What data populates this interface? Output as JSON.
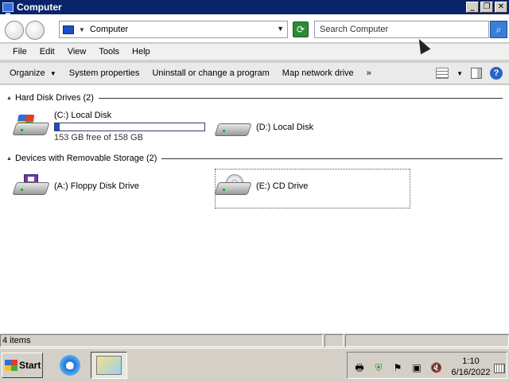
{
  "window": {
    "title": "Computer"
  },
  "title_controls": {
    "minimize": "_",
    "restore": "❐",
    "close": "✕"
  },
  "address": {
    "location": "Computer",
    "search_placeholder": "Search Computer"
  },
  "menu": [
    "File",
    "Edit",
    "View",
    "Tools",
    "Help"
  ],
  "commands": {
    "organize": "Organize",
    "system_properties": "System properties",
    "uninstall": "Uninstall or change a program",
    "map_drive": "Map network drive",
    "more": "»"
  },
  "groups": {
    "hard_disks": {
      "header": "Hard Disk Drives (2)",
      "items": [
        {
          "name": "(C:) Local Disk",
          "free_text": "153 GB free of 158 GB",
          "used_fraction": 0.03
        },
        {
          "name": "(D:) Local Disk"
        }
      ]
    },
    "removable": {
      "header": "Devices with Removable Storage (2)",
      "items": [
        {
          "name": "(A:) Floppy Disk Drive"
        },
        {
          "name": "(E:) CD Drive"
        }
      ]
    }
  },
  "status": {
    "items": "4 items"
  },
  "taskbar": {
    "start": "Start",
    "time": "1:10",
    "date": "6/16/2022"
  },
  "colors": {
    "title_bar": "#0a246a",
    "progress_fill": "#1a4fc2",
    "system_face": "#d4d0c8"
  }
}
